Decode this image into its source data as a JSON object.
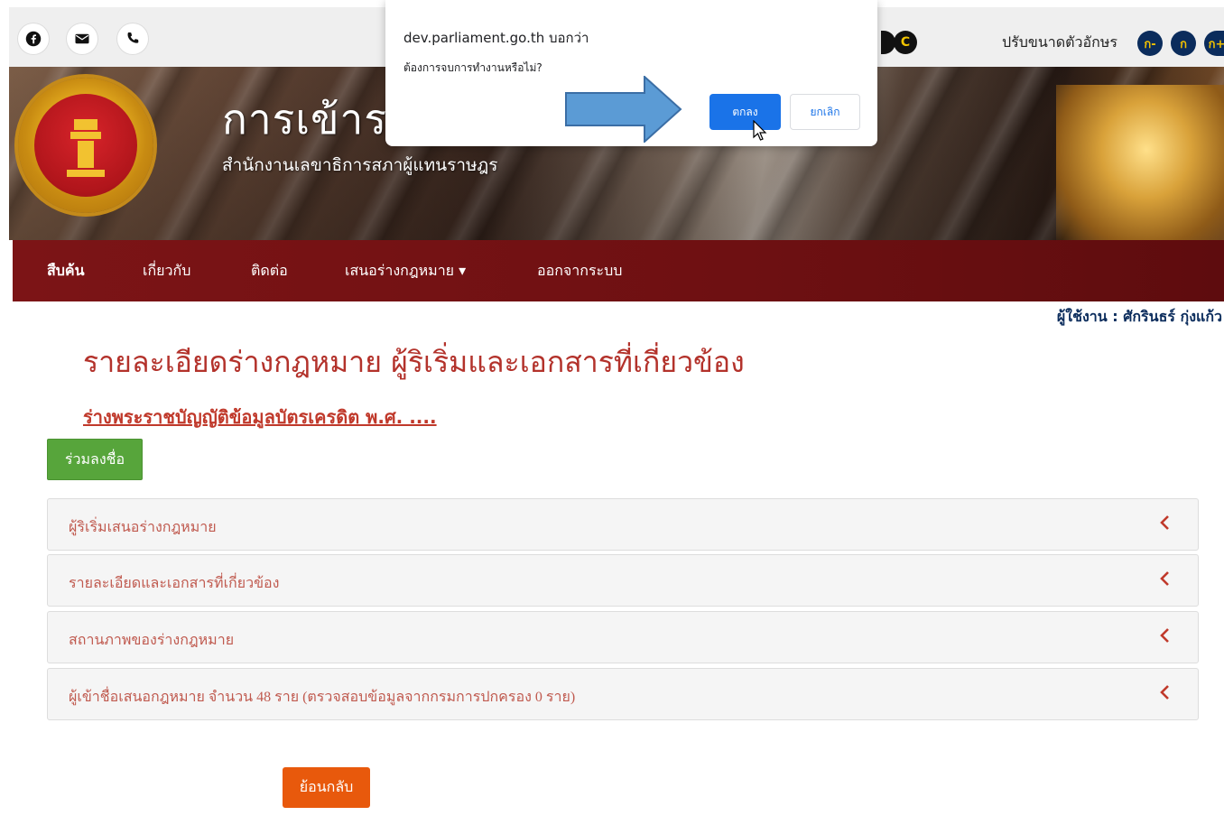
{
  "topbar": {
    "social_icons": [
      "facebook-icon",
      "email-icon",
      "phone-icon"
    ],
    "contrast_label": "C",
    "font_size_label": "ปรับขนาดตัวอักษร",
    "font_size_buttons": [
      "ก-",
      "ก",
      "ก+"
    ]
  },
  "banner": {
    "title": "การเข้าร",
    "subtitle": "สำนักงานเลขาธิการสภาผู้แทนราษฎร"
  },
  "nav": {
    "items": [
      {
        "label": "สืบค้น"
      },
      {
        "label": "เกี่ยวกับ"
      },
      {
        "label": "ติดต่อ"
      },
      {
        "label": "เสนอร่างกฎหมาย ▾"
      },
      {
        "label": "ออกจากระบบ"
      }
    ]
  },
  "user": {
    "text": "ผู้ใช้งาน : ศักรินธร์ กุ่งแก้ว"
  },
  "main": {
    "page_title": "รายละเอียดร่างกฎหมาย ผู้ริเริ่มและเอกสารที่เกี่ยวข้อง",
    "bill_link": "ร่างพระราชบัญญัติข้อมูลบัตรเครดิต พ.ศ. ....",
    "sign_button": "ร่วมลงชื่อ",
    "panels": [
      {
        "label": "ผู้ริเริ่มเสนอร่างกฎหมาย"
      },
      {
        "label": "รายละเอียดและเอกสารที่เกี่ยวข้อง"
      },
      {
        "label": "สถานภาพของร่างกฎหมาย"
      },
      {
        "label": "ผู้เข้าชื่อเสนอกฎหมาย  จำนวน  48  ราย  (ตรวจสอบข้อมูลจากกรมการปกครอง 0 ราย)"
      }
    ],
    "back_button": "ย้อนกลับ"
  },
  "dialog": {
    "origin": "dev.parliament.go.th บอกว่า",
    "message": "ต้องการจบการทำงานหรือไม่?",
    "ok_label": "ตกลง",
    "cancel_label": "ยกเลิก"
  },
  "colors": {
    "nav_bg": "#7c1416",
    "title_red": "#b3322b",
    "sign_green": "#57a53b",
    "back_orange": "#e8590c",
    "dialog_blue": "#1a73e8",
    "font_btn_navy": "#0b2c5c"
  }
}
